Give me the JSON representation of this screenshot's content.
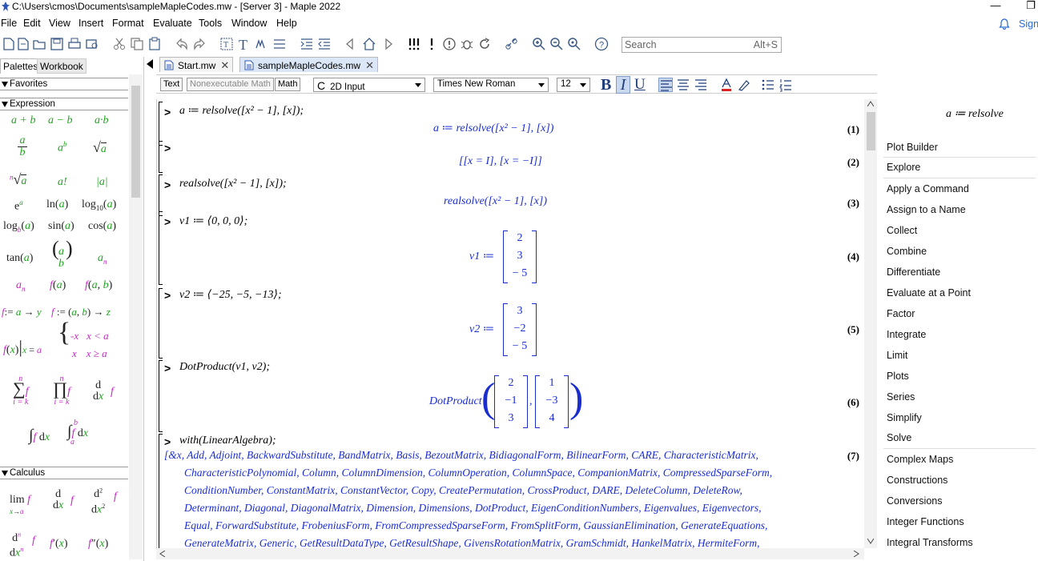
{
  "window": {
    "title": "C:\\Users\\cmos\\Documents\\sampleMapleCodes.mw - [Server 3] - Maple 2022",
    "minimize": "—",
    "restore": "❐"
  },
  "menu": {
    "items": [
      "File",
      "Edit",
      "View",
      "Insert",
      "Format",
      "Evaluate",
      "Tools",
      "Window",
      "Help"
    ],
    "sign_in": "Sign"
  },
  "search": {
    "placeholder": "Search",
    "shortcut": "Alt+S"
  },
  "left_tabs": [
    "Palettes",
    "Workbook"
  ],
  "palettes": {
    "favorites": "Favorites",
    "expression": "Expression",
    "calculus": "Calculus"
  },
  "doc_tabs": [
    {
      "label": "Start.mw",
      "close": "✕"
    },
    {
      "label": "sampleMapleCodes.mw",
      "close": "✕"
    }
  ],
  "format_bar": {
    "text_btn": "Text",
    "nonexec_btn": "Nonexecutable Math",
    "math_btn": "Math",
    "input_mode": "2D Input",
    "input_mode_icon": "C",
    "font": "Times New Roman",
    "size": "12",
    "bold": "B",
    "italic": "I",
    "underline": "U"
  },
  "worksheet": {
    "prompt": ">",
    "cells": [
      {
        "input": "a ≔ relsolve([x² − 1], [x]);",
        "output": "a ≔ relsolve([x² − 1], [x])",
        "label": "(1)"
      },
      {
        "input": "",
        "output": "[[x = I], [x = −I]]",
        "label": "(2)"
      },
      {
        "input": "realsolve([x² − 1], [x]);",
        "output": "realsolve([x² − 1], [x])",
        "label": "(3)"
      },
      {
        "input": "v1 ≔ ⟨0, 0, 0⟩;",
        "output_lhs": "v1 ≔",
        "vector": [
          "2",
          "3",
          "− 5"
        ],
        "label": "(4)"
      },
      {
        "input": "v2 ≔ ⟨−25, −5, −13⟩;",
        "output_lhs": "v2 ≔",
        "vector": [
          "3",
          "−2",
          "− 5"
        ],
        "label": "(5)"
      },
      {
        "input": "DotProduct(v1, v2);",
        "output_lhs": "DotProduct",
        "vector_a": [
          "2",
          "−1",
          "3"
        ],
        "vector_b": [
          "1",
          "−3",
          "4"
        ],
        "label": "(6)"
      },
      {
        "input": "with(LinearAlgebra);",
        "label": "(7)"
      }
    ],
    "linalg_lines": [
      "[&x, Add, Adjoint, BackwardSubstitute, BandMatrix, Basis, BezoutMatrix, BidiagonalForm, BilinearForm, CARE, CharacteristicMatrix,",
      "CharacteristicPolynomial, Column, ColumnDimension, ColumnOperation, ColumnSpace, CompanionMatrix, CompressedSparseForm,",
      "ConditionNumber, ConstantMatrix, ConstantVector, Copy, CreatePermutation, CrossProduct, DARE, DeleteColumn, DeleteRow,",
      "Determinant, Diagonal, DiagonalMatrix, Dimension, Dimensions, DotProduct, EigenConditionNumbers, Eigenvalues, Eigenvectors,",
      "Equal, ForwardSubstitute, FrobeniusForm, FromCompressedSparseForm, FromSplitForm, GaussianElimination, GenerateEquations,",
      "GenerateMatrix, Generic, GetResultDataType, GetResultShape, GivensRotationMatrix, GramSchmidt, HankelMatrix, HermiteForm,"
    ]
  },
  "context_panel": {
    "preview": "a ≔ relsolve",
    "items": [
      "Plot Builder",
      "Explore",
      "Apply a Command",
      "Assign to a Name",
      "Collect",
      "Combine",
      "Differentiate",
      "Evaluate at a Point",
      "Factor",
      "Integrate",
      "Limit",
      "Plots",
      "Series",
      "Simplify",
      "Solve",
      "Complex Maps",
      "Constructions",
      "Conversions",
      "Integer Functions",
      "Integral Transforms"
    ]
  }
}
